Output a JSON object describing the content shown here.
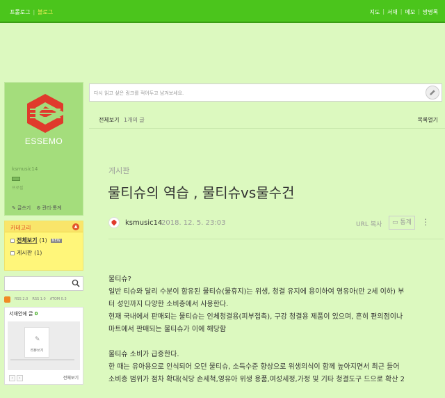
{
  "topbar": {
    "left": [
      "프롤로그",
      "블로그"
    ],
    "right": [
      "지도",
      "서재",
      "메모",
      "방명록"
    ]
  },
  "profile": {
    "logo_text": "ESSEMO",
    "user_id": "ksmusic14",
    "subtitle": "프로필",
    "write": "글쓰기",
    "admin": "관리·통계"
  },
  "categories": {
    "title": "카테고리",
    "items": [
      {
        "label": "전체보기",
        "count": "(1)",
        "badge": "NEW"
      },
      {
        "label": "게시판",
        "count": "(1)",
        "badge": ""
      }
    ]
  },
  "rss": [
    "RSS 2.0",
    "RSS 1.0",
    "ATOM 0.3"
  ],
  "guestbook": {
    "title": "서재안에 글",
    "count": "0",
    "card_label": "리뷰쓰기",
    "all_label": "전체보기"
  },
  "urlbar": {
    "placeholder": "다시 읽고 싶은 링크를 적어두고 남겨보세요."
  },
  "list": {
    "title": "전체보기",
    "count": "1개의 글",
    "toggle": "목록열기"
  },
  "post": {
    "category": "게시판",
    "title": "물티슈의 역습 , 물티슈vs물수건",
    "author": "ksmusic14",
    "date": "2018. 12. 5. 23:03",
    "url_copy": "URL 복사",
    "stats": "통계",
    "more": "⋮",
    "lines": [
      "물티슈?",
      "일반 티슈와 달리 수분이 함유된 물티슈(물휴지)는 위생, 청결 유지에 용이하여 영유아(만 2세 이하) 부",
      "터 성인까지 다양한 소비층에서 사용한다.",
      "현재 국내에서 판매되는 물티슈는 인체청결용(피부접촉), 구강 청결용 제품이 있으며, 흔히 편의점이나",
      "마트에서 판매되는 물티슈가 이에 해당함",
      "",
      "물티슈 소비가 급증한다.",
      "한 때는 유아용으로 인식되어 오던 물티슈, 소득수준 향상으로 위생의식이 함께 높아지면서 최근 들어",
      "소비층 범위가 점차 확대(식당 손세척,영유아 위생 용품,여성세정,가정 및 기타 청결도구 드으로 확산 2"
    ]
  },
  "colors": {
    "topbar": "#4bc51c",
    "background": "#dcf9bf",
    "sidebar_profile": "#a4dd7c",
    "category_box": "#fff67a",
    "logo_red": "#e03a2c"
  }
}
